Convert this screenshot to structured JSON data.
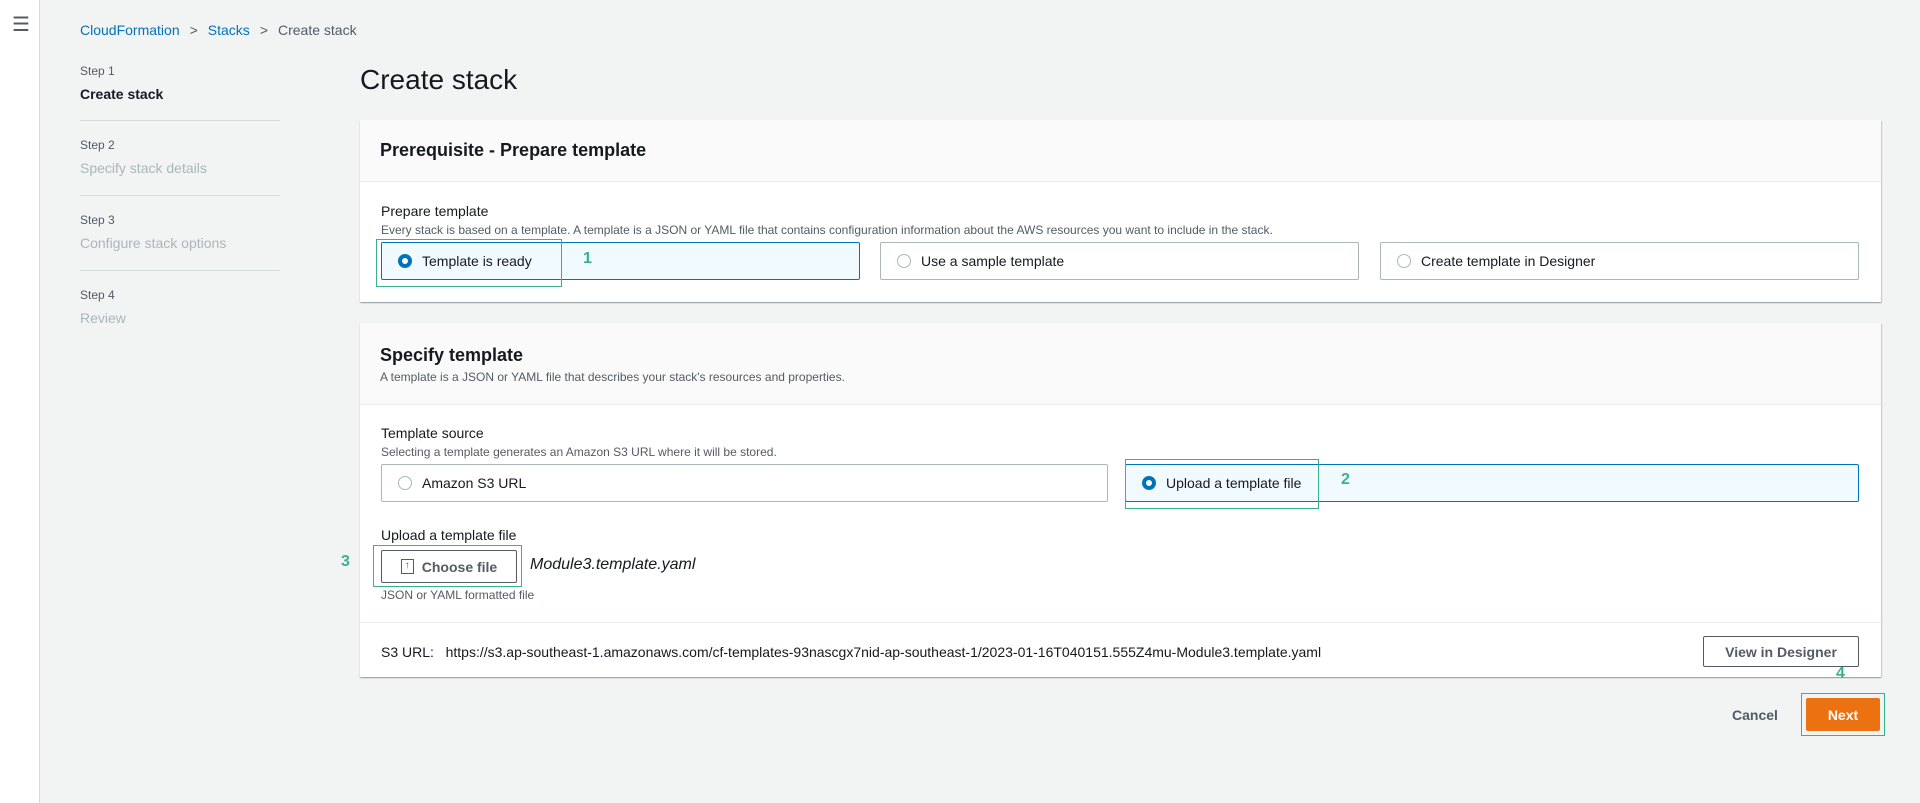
{
  "breadcrumb": [
    "CloudFormation",
    "Stacks",
    "Create stack"
  ],
  "steps": [
    {
      "n": "Step 1",
      "l": "Create stack"
    },
    {
      "n": "Step 2",
      "l": "Specify stack details"
    },
    {
      "n": "Step 3",
      "l": "Configure stack options"
    },
    {
      "n": "Step 4",
      "l": "Review"
    }
  ],
  "title": "Create stack",
  "prereq": {
    "header": "Prerequisite - Prepare template",
    "label": "Prepare template",
    "desc": "Every stack is based on a template. A template is a JSON or YAML file that contains configuration information about the AWS resources you want to include in the stack.",
    "options": [
      "Template is ready",
      "Use a sample template",
      "Create template in Designer"
    ],
    "selected": 0
  },
  "specify": {
    "header": "Specify template",
    "header_desc": "A template is a JSON or YAML file that describes your stack's resources and properties.",
    "source_label": "Template source",
    "source_desc": "Selecting a template generates an Amazon S3 URL where it will be stored.",
    "options": [
      "Amazon S3 URL",
      "Upload a template file"
    ],
    "selected": 1,
    "upload_label": "Upload a template file",
    "choose_file": "Choose file",
    "file_name": "Module3.template.yaml",
    "file_hint": "JSON or YAML formatted file",
    "s3_label": "S3 URL:",
    "s3_url": "https://s3.ap-southeast-1.amazonaws.com/cf-templates-93nascgx7nid-ap-southeast-1/2023-01-16T040151.555Z4mu-Module3.template.yaml",
    "view_designer": "View in Designer"
  },
  "footer": {
    "cancel": "Cancel",
    "next": "Next"
  },
  "annotations": [
    "1",
    "2",
    "3",
    "4"
  ],
  "colors": {
    "accent": "#0073bb",
    "primary": "#ec7211",
    "annotation": "#3bb08f"
  }
}
